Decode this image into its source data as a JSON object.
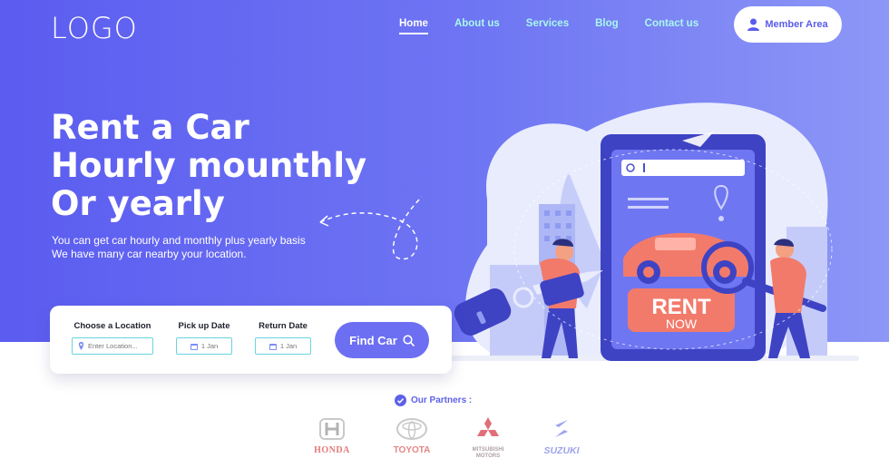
{
  "header": {
    "logo": "LOGO",
    "nav": [
      {
        "label": "Home",
        "active": true
      },
      {
        "label": "About us"
      },
      {
        "label": "Services"
      },
      {
        "label": "Blog"
      },
      {
        "label": "Contact us"
      }
    ],
    "member_label": "Member Area"
  },
  "hero": {
    "headline": [
      "Rent a Car",
      "Hourly mounthly",
      "Or yearly"
    ],
    "subtitle": [
      "You can get car hourly and monthly plus yearly basis",
      "We have many car nearby your location."
    ]
  },
  "search": {
    "location_label": "Choose a Location",
    "location_placeholder": "Enter Location...",
    "pickup_label": "Pick up Date",
    "pickup_value": "1 Jan",
    "return_label": "Return Date",
    "return_value": "1 Jan",
    "find_label": "Find Car"
  },
  "illustration": {
    "rent": "RENT",
    "now": "NOW"
  },
  "partners": {
    "title": "Our Partners :",
    "brands": [
      {
        "name": "HONDA",
        "color": "#e27b7b"
      },
      {
        "name": "TOYOTA",
        "color": "#e58686"
      },
      {
        "name": "MITSUBISHI MOTORS",
        "line1": "MITSUBISHI",
        "line2": "MOTORS",
        "color": "#e06f7a"
      },
      {
        "name": "SUZUKI",
        "color": "#9ea2ec"
      }
    ]
  },
  "colors": {
    "hero_start": "#5b5cf0",
    "hero_end": "#8d97f6",
    "accent": "#6d6ff2",
    "nav": "#a9f7ef"
  }
}
